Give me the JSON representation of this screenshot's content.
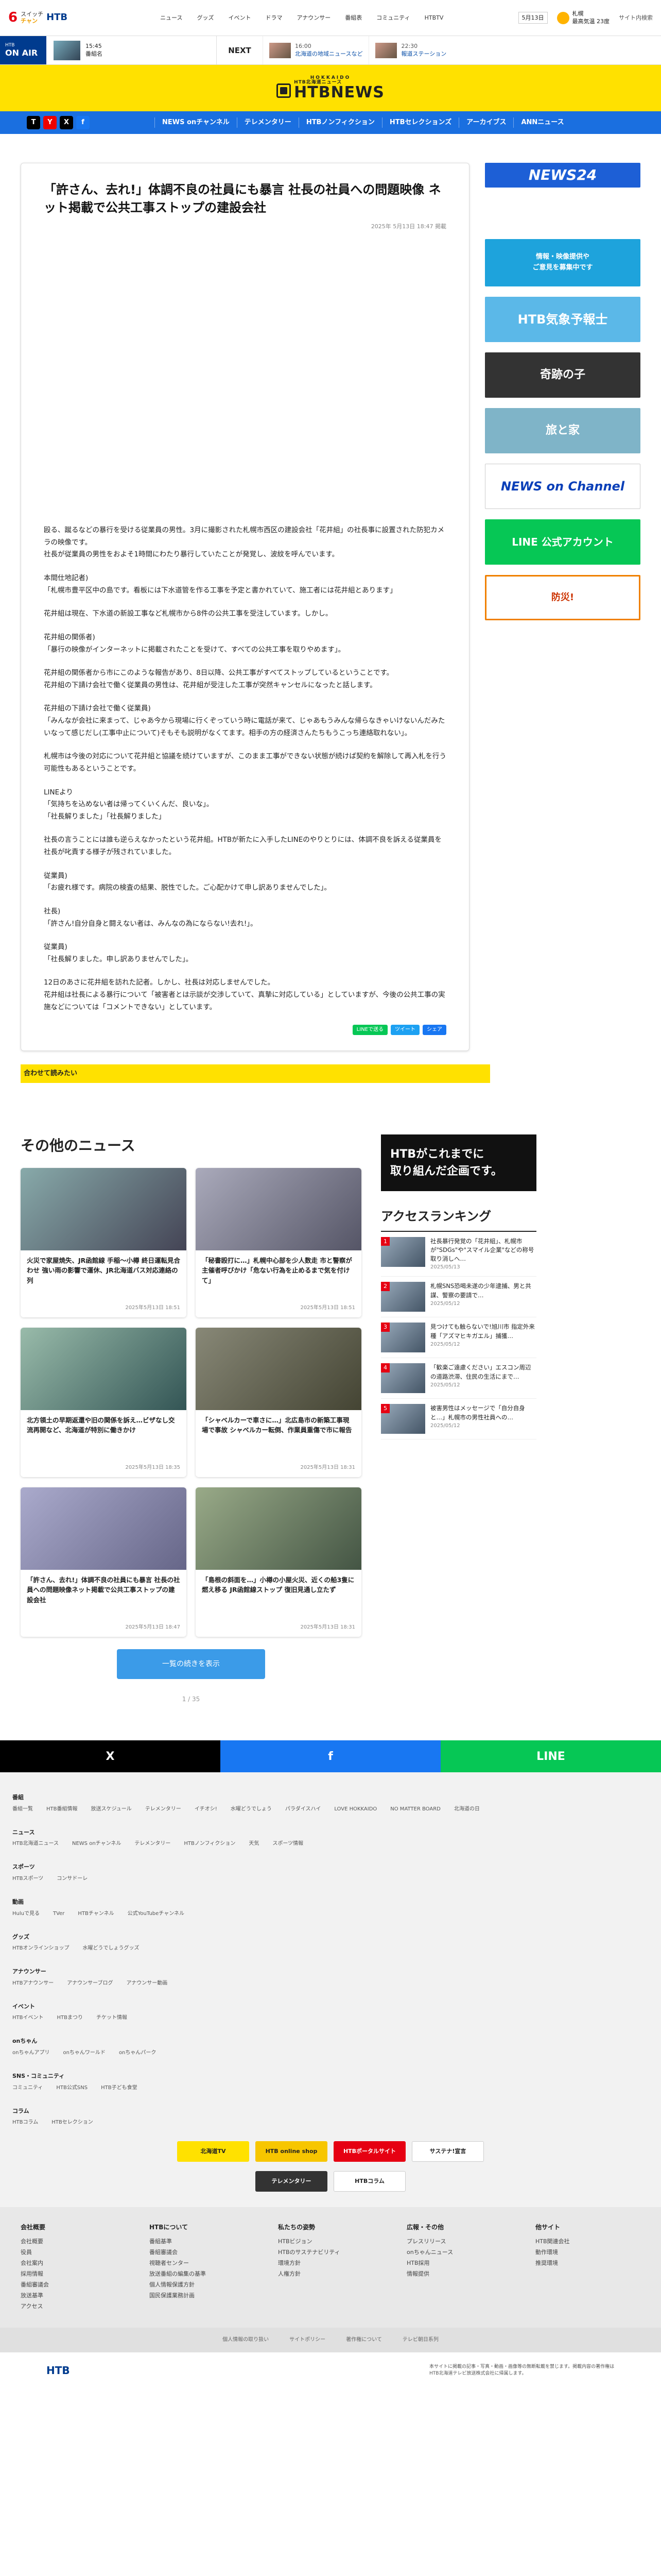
{
  "header": {
    "logo_six": "6",
    "logo_sub_top": "スイッチ",
    "logo_sub_bottom": "チャン",
    "logo_htb": "HTB",
    "nav": [
      "ニュース",
      "グッズ",
      "イベント",
      "ドラマ",
      "アナウンサー",
      "番組表",
      "コミュニティ",
      "HTBTV"
    ],
    "date": "5月13日",
    "weather_place": "札幌",
    "weather_value": "最高気温 23度",
    "aux": "サイト内検索"
  },
  "onair": {
    "label_small": "HTB",
    "label": "ON AIR",
    "now_time": "15:45",
    "now_title": "番組名",
    "next_label": "NEXT",
    "next_items": [
      {
        "time": "16:00",
        "title": "北海道の地域ニュースなど"
      },
      {
        "time": "22:30",
        "title": "報道ステーション"
      }
    ]
  },
  "brand": {
    "top": "HOKKAIDO",
    "name": "HTBNEWS",
    "sub": "HTB北海道ニュース"
  },
  "mainnav": {
    "social": [
      "T",
      "Y",
      "X",
      "f"
    ],
    "items": [
      "NEWS onチャンネル",
      "テレメンタリー",
      "HTBノンフィクション",
      "HTBセレクションズ",
      "アーカイブス",
      "ANNニュース"
    ]
  },
  "article": {
    "headline": "「許さん、去れ!」体調不良の社員にも暴言 社長の社員への問題映像 ネット掲載で公共工事ストップの建設会社",
    "date": "2025年 5月13日 18:47 掲載",
    "paragraphs": [
      "殴る、蹴るなどの暴行を受ける従業員の男性。3月に撮影された札幌市西区の建設会社「花井組」の社長事に設置された防犯カメラの映像です。\n社長が従業員の男性をおよそ1時間にわたり暴行していたことが発覚し、波紋を呼んでいます。",
      "本間仕地記者)\n「札幌市豊平区中の島です。看板には下水道管を作る工事を予定と書かれていて、施工者には花井組とあります」",
      "花井組は現在、下水道の新設工事など札幌市から8件の公共工事を受注しています。しかし。",
      "花井組の関係者)\n「暴行の映像がインターネットに掲載されたことを受けて、すべての公共工事を取りやめます」。",
      "花井組の関係者から市にこのような報告があり、8日以降、公共工事がすべてストップしているということです。\n花井組の下請け会社で働く従業員の男性は、花井組が受注した工事が突然キャンセルになったと話します。",
      "花井組の下請け会社で働く従業員)\n「みんなが会社に来まって、じゃあ今から現場に行くぞっていう時に電話が来て、じゃあもうみんな帰らなきゃいけないんだみたいなって感じだし(工事中止について)そもそも説明がなくてます。相手の方の経済さんたちもうこっち連絡取れない」。",
      "札幌市は今後の対応について花井組と協議を続けていますが、このまま工事ができない状態が続けば契約を解除して再入札を行う可能性もあるということです。",
      "LINEより\n「気持ちを込めない者は帰ってくいくんだ、良いな」。\n「社長解りました」「社長解りました」",
      "社長の言うことには誰も逆らえなかったという花井組。HTBが新たに入手したLINEのやりとりには、体調不良を訴える従業員を社長が叱責する様子が残されていました。",
      "従業員)\n「お疲れ様です。病院の検査の結果、脱性でした。ご心配かけて申し訳ありませんでした」。",
      "社長)\n「許さん!自分自身と闘えない者は、みんなの為にならない!去れ!」。",
      "従業員)\n「社長解りました。申し訳ありませんでした」。",
      "12日のあさに花井組を訪れた記者。しかし、社長は対応しませんでした。\n花井組は社長による暴行について「被害者とは示談が交渉していて、真摯に対応している」としていますが、今後の公共工事の実施などについては「コメントできない」としています。"
    ],
    "share": [
      "LINEで送る",
      "ツイート",
      "シェア"
    ]
  },
  "yellowbar": "合わせて読みたい",
  "sidebar": {
    "news24": "NEWS24",
    "weather_line1": "情報・映像提供や",
    "weather_line2": "ご意見を募集中です",
    "htbweather": "HTB気象予報士",
    "miracle": "奇跡の子",
    "tabi": "旅と家",
    "oc": "NEWS on Channel",
    "line": "LINE 公式アカウント",
    "bousai": "防災!"
  },
  "othernews": {
    "title": "その他のニュース",
    "cards": [
      {
        "title": "火災で家屋焼失、JR函館線 手稲〜小樽 終日運転見合わせ 強い雨の影響で運休、JR北海道バス対応連絡の列",
        "date": "2025年5月13日 18:51"
      },
      {
        "title": "「秘書殴打に…」札幌中心部を少人数走 市と警察が主催者呼びかけ「危ない行為を止めるまで気を付けて」",
        "date": "2025年5月13日 18:51"
      },
      {
        "title": "北方領土の早期返還や旧の関係を訴え…ビザなし交流再開など、北海道が特別に働きかけ",
        "date": "2025年5月13日 18:35"
      },
      {
        "title": "「シャベルカーで車さに…」北広島市の新築工事現場で事故 シャベルカー転倒、作業員重傷で市に報告",
        "date": "2025年5月13日 18:31"
      },
      {
        "title": "「許さん、去れ!」体調不良の社員にも暴言 社長の社員への問題映像ネット掲載で公共工事ストップの建設会社",
        "date": "2025年5月13日 18:47"
      },
      {
        "title": "「島根の斜面を…」小樽の小屋火災、近くの船3隻に燃え移る JR函館線ストップ 復旧見通し立たず",
        "date": "2025年5月13日 18:31"
      }
    ],
    "more": "一覧の続きを表示",
    "pager": "1 / 35"
  },
  "ranking": {
    "promo1": "HTBがこれまでに",
    "promo2": "取り組んだ企画です。",
    "title": "アクセスランキング",
    "items": [
      {
        "num": "1",
        "title": "社長暴行発覚の「花井組」、札幌市が\"SDGs\"や\"スマイル企業\"などの称号取り消しへ…",
        "date": "2025/05/13"
      },
      {
        "num": "2",
        "title": "札幌SNS恐喝未遂の少年逮捕、男と共謀、警察の要請で…",
        "date": "2025/05/12"
      },
      {
        "num": "3",
        "title": "見つけても触らないで!旭川市 指定外来種「アズマヒキガエル」捕獲…",
        "date": "2025/05/12"
      },
      {
        "num": "4",
        "title": "「歓楽ご遠慮ください」エスコン周辺の道路渋滞、住民の生活にまで…",
        "date": "2025/05/12"
      },
      {
        "num": "5",
        "title": "被害男性はメッセージで「自分自身と…」札幌市の男性社員への…",
        "date": "2025/05/12"
      }
    ]
  },
  "sharestrip": {
    "x": "X",
    "fb": "f",
    "line": "LINE"
  },
  "sitemap": {
    "groups": [
      {
        "head": "番組",
        "links": [
          "番組一覧",
          "HTB番組情報",
          "放送スケジュール",
          "テレメンタリー",
          "イチオシ!",
          "水曜どうでしょう",
          "パラダイスハイ",
          "LOVE HOKKAIDO",
          "NO MATTER BOARD",
          "北海道の日"
        ]
      },
      {
        "head": "ニュース",
        "links": [
          "HTB北海道ニュース",
          "NEWS onチャンネル",
          "テレメンタリー",
          "HTBノンフィクション",
          "天気",
          "スポーツ情報"
        ]
      },
      {
        "head": "スポーツ",
        "links": [
          "HTBスポーツ",
          "コンサドーレ"
        ]
      },
      {
        "head": "動画",
        "links": [
          "Huluで見る",
          "TVer",
          "HTBチャンネル",
          "公式YouTubeチャンネル"
        ]
      },
      {
        "head": "グッズ",
        "links": [
          "HTBオンラインショップ",
          "水曜どうでしょうグッズ"
        ]
      },
      {
        "head": "アナウンサー",
        "links": [
          "HTBアナウンサー",
          "アナウンサーブログ",
          "アナウンサー動画"
        ]
      },
      {
        "head": "イベント",
        "links": [
          "HTBイベント",
          "HTBまつり",
          "チケット情報"
        ]
      },
      {
        "head": "onちゃん",
        "links": [
          "onちゃんアプリ",
          "onちゃんワールド",
          "onちゃんパーク"
        ]
      },
      {
        "head": "SNS・コミュニティ",
        "links": [
          "コミュニティ",
          "HTB公式SNS",
          "HTB子ども食堂"
        ]
      },
      {
        "head": "コラム",
        "links": [
          "HTBコラム",
          "HTBセレクション"
        ]
      }
    ],
    "banners": [
      "北海道TV",
      "HTB online shop",
      "HTBポータルサイト",
      "サステナ!宣言",
      "テレメンタリー",
      "HTBコラム"
    ]
  },
  "footer": {
    "cols": [
      {
        "head": "会社概要",
        "items": [
          "会社概要",
          "役員",
          "会社案内",
          "採用情報",
          "番組審議会",
          "放送基準",
          "アクセス"
        ]
      },
      {
        "head": "HTBについて",
        "items": [
          "番組基準",
          "番組審議会",
          "視聴者センター",
          "放送番組の編集の基準",
          "個人情報保護方針",
          "国民保護業務計画"
        ]
      },
      {
        "head": "私たちの姿勢",
        "items": [
          "HTBビジョン",
          "HTBのサステナビリティ",
          "環境方針",
          "人権方針"
        ]
      },
      {
        "head": "広報・その他",
        "items": [
          "プレスリリース",
          "onちゃんニュース",
          "HTB採用",
          "情報提供"
        ]
      },
      {
        "head": "他サイト",
        "items": [
          "HTB関連会社",
          "動作環境",
          "推奨環境"
        ]
      }
    ],
    "bottom_links": [
      "個人情報の取り扱い",
      "サイトポリシー",
      "著作権について",
      "テレビ朝日系列"
    ],
    "copyright": "本サイトに掲載の記事・写真・動画・画像等の無断転載を禁じます。掲載内容の著作権はHTB北海道テレビ放送株式会社に帰属します。",
    "bottom_logo": "HTB"
  }
}
